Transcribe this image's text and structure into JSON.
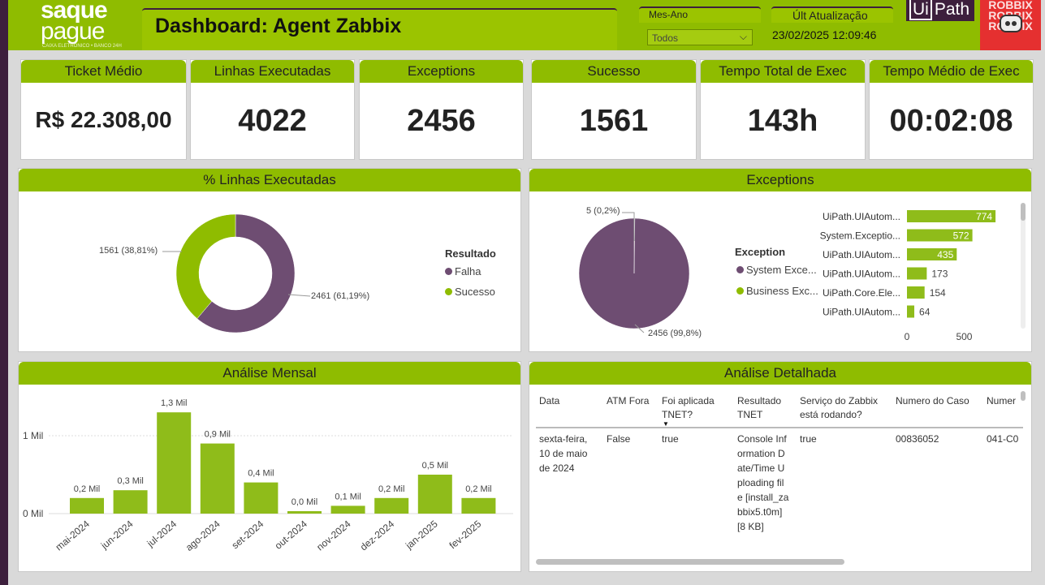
{
  "header": {
    "title": "Dashboard: Agent Zabbix",
    "logo_line1": "saque",
    "logo_line2": "pague",
    "logo_tagline": "CAIXA ELETRÔNICO • BANCO 24H",
    "filter_label": "Mes-Ano",
    "filter_value": "Todos",
    "update_label": "Últ Atualização",
    "update_value": "23/02/2025 12:09:46",
    "uipath_ui": "Ui",
    "uipath_path": "Path",
    "robo_text": "ROBBIX ROBBIX ROBBIX"
  },
  "kpis": [
    {
      "label": "Ticket Médio",
      "value": "R$ 22.308,00"
    },
    {
      "label": "Linhas Executadas",
      "value": "4022"
    },
    {
      "label": "Exceptions",
      "value": "2456"
    },
    {
      "label": "Sucesso",
      "value": "1561"
    },
    {
      "label": "Tempo Total de Exec",
      "value": "143h"
    },
    {
      "label": "Tempo Médio de Exec",
      "value": "00:02:08"
    }
  ],
  "donut1": {
    "title": "% Linhas Executadas",
    "legend_title": "Resultado",
    "legend": [
      "Falha",
      "Sucesso"
    ],
    "label_sucesso": "1561 (38,81%)",
    "label_falha": "2461 (61,19%)"
  },
  "exceptions": {
    "title": "Exceptions",
    "legend_title": "Exception",
    "legend": [
      "System Exce...",
      "Business Exc..."
    ],
    "label_small": "5 (0,2%)",
    "label_big": "2456 (99,8%)",
    "bar_labels": [
      "UiPath.UIAutom...",
      "System.Exceptio...",
      "UiPath.UIAutom...",
      "UiPath.UIAutom...",
      "UiPath.Core.Ele...",
      "UiPath.UIAutom..."
    ],
    "bar_values": [
      "774",
      "572",
      "435",
      "173",
      "154",
      "64"
    ],
    "axis": [
      "0",
      "500"
    ]
  },
  "mensal": {
    "title": "Análise Mensal",
    "y_ticks": [
      "1 Mil",
      "0 Mil"
    ]
  },
  "detalhe": {
    "title": "Análise Detalhada",
    "columns": [
      "Data",
      "ATM Fora",
      "Foi aplicada TNET?",
      "Resultado TNET",
      "Serviço do Zabbix está rodando?",
      "Numero do Caso",
      "Numer"
    ],
    "row": [
      "sexta-feira, 10 de maio de 2024",
      "False",
      "true",
      "Console Information Date/Time Uploading file [install_zabbix5.t0m] [8 KB]",
      "true",
      "00836052",
      "041-C0"
    ]
  },
  "colors": {
    "green": "#8fbc00",
    "purple": "#6e4d72",
    "bar_green": "#8fbc1a"
  },
  "chart_data": [
    {
      "type": "pie",
      "title": "% Linhas Executadas",
      "categories": [
        "Falha",
        "Sucesso"
      ],
      "values": [
        2461,
        1561
      ],
      "percent": [
        61.19,
        38.81
      ]
    },
    {
      "type": "pie",
      "title": "Exceptions",
      "categories": [
        "System Exce...",
        "Business Exc..."
      ],
      "values": [
        2456,
        5
      ],
      "percent": [
        99.8,
        0.2
      ]
    },
    {
      "type": "bar",
      "categories": [
        "UiPath.UIAutom...",
        "System.Exceptio...",
        "UiPath.UIAutom...",
        "UiPath.UIAutom...",
        "UiPath.Core.Ele...",
        "UiPath.UIAutom..."
      ],
      "values": [
        774,
        572,
        435,
        173,
        154,
        64
      ],
      "xlim": [
        0,
        880
      ]
    },
    {
      "type": "bar",
      "title": "Análise Mensal",
      "categories": [
        "mai-2024",
        "jun-2024",
        "jul-2024",
        "ago-2024",
        "set-2024",
        "out-2024",
        "nov-2024",
        "dez-2024",
        "jan-2025",
        "fev-2025"
      ],
      "values": [
        0.2,
        0.3,
        1.3,
        0.9,
        0.4,
        0.0,
        0.1,
        0.2,
        0.5,
        0.2
      ],
      "labels": [
        "0,2 Mil",
        "0,3 Mil",
        "1,3 Mil",
        "0,9 Mil",
        "0,4 Mil",
        "0,0 Mil",
        "0,1 Mil",
        "0,2 Mil",
        "0,5 Mil",
        "0,2 Mil"
      ],
      "ylim": [
        0,
        1.3
      ]
    }
  ]
}
